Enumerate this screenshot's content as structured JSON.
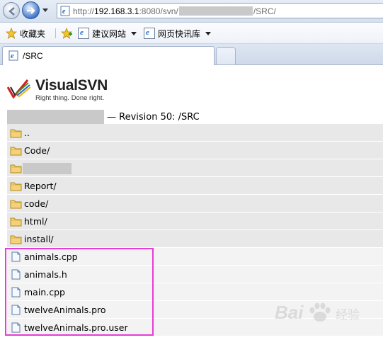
{
  "browser": {
    "url": {
      "scheme": "http://",
      "host": "192.168.3.1",
      "port_path": ":8080/svn/",
      "suffix": "/SRC/"
    },
    "favorites": {
      "label": "收藏夹",
      "items": [
        {
          "label": "建议网站"
        },
        {
          "label": "网页快讯库"
        }
      ]
    },
    "tab": {
      "title": "/SRC"
    }
  },
  "page": {
    "logo": {
      "name": "VisualSVN",
      "tagline": "Right thing. Done right."
    },
    "revision_text": "— Revision 50: /SRC",
    "entries": [
      {
        "name": "..",
        "type": "folder"
      },
      {
        "name": "Code/",
        "type": "folder"
      },
      {
        "name": "",
        "type": "folder",
        "redacted": true
      },
      {
        "name": "Report/",
        "type": "folder"
      },
      {
        "name": "code/",
        "type": "folder"
      },
      {
        "name": "html/",
        "type": "folder"
      },
      {
        "name": "install/",
        "type": "folder"
      },
      {
        "name": "animals.cpp",
        "type": "file"
      },
      {
        "name": "animals.h",
        "type": "file"
      },
      {
        "name": "main.cpp",
        "type": "file"
      },
      {
        "name": "twelveAnimals.pro",
        "type": "file"
      },
      {
        "name": "twelveAnimals.pro.user",
        "type": "file"
      }
    ],
    "highlight_color": "#e83cd6"
  },
  "watermark": {
    "brand": "Bai",
    "suffix": "经验"
  }
}
